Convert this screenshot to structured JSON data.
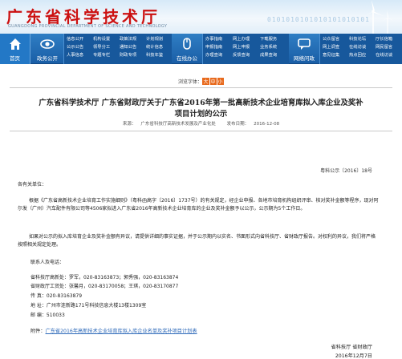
{
  "header": {
    "title": "广东省科学技术厅",
    "subtitle": "GUANGDONG PROVINCIAL DEPARTMENT OF SCIENCE AND TECHNOLOGY",
    "binary_rows": [
      "0101010101010101010101",
      "1010101010101010101010",
      "0101010101010101010101",
      "1010101010101010101010"
    ]
  },
  "nav": {
    "home": "首页",
    "gov_open": {
      "label": "政务公开",
      "links": [
        "信息公开",
        "机构设置",
        "政策法规",
        "计划规划",
        "公示公告",
        "领导分工",
        "通知公告",
        "统计信息",
        "人事信息",
        "专题专栏",
        "财政专项",
        "科技年鉴"
      ]
    },
    "online": {
      "label": "在线办公",
      "links": [
        "办事指南",
        "网上办理",
        "下载服务",
        "申报指南",
        "网上申报",
        "业务系统",
        "办理查询",
        "反馈查询",
        "成果查询"
      ]
    },
    "interact": {
      "label": "网络问政",
      "links": [
        "公众留言",
        "科技论坛",
        "厅长信箱",
        "网上调查",
        "在线访谈",
        "网民留言",
        "意见征集",
        "热点回应",
        "在线访谈"
      ]
    }
  },
  "font_line": {
    "prefix": "浏览字体：",
    "options": [
      "大",
      "中",
      "小"
    ]
  },
  "document": {
    "title_line1": "广东省科学技术厅  广东省财政厅关于广东省2016年第一批高新技术企业培育库拟入库企业及奖补",
    "title_line2": "项目计划的公示",
    "source_label": "来源：",
    "source": "广东省科技厅高新技术发展及产业化处",
    "date_label": "发布日期：",
    "date": "2016-12-08",
    "doc_number": "粤科公示〔2016〕18号",
    "salutation": "各有关单位：",
    "para1": "根据《广东省高新技术企业培育工作实施细则》（粤科函高字〔2016〕1737号）的有关规定，经企业申报、各地市培育机构组织评审、核对奖补金额等程序，现对阿尔发（广州）汽车配件有限公司等4506家拟进入广东省2016年高新技术企业培育库的企业及奖补金额予以公示，公示期为5个工作日。",
    "para2": "如果对公示的拟入库培育企业及奖补金额有异议，请提供详细的事实证据，并于公示期内以实名、书面形式向省科技厅、省财政厅报告。对权利的异议，我们将严格按照相关规定处理。",
    "contacts_title": "联系人及电话：",
    "contacts": [
      "省科技厅高新处：罗军，020-83163873；郭秀强，020-83163874",
      "省财政厅工贸处：张馨月，020-83170058；王琪，020-83170877",
      "传  真：020-83163879",
      "地  址：广州市连新路171号科技信息大楼13楼1309室",
      "邮  编：510033"
    ],
    "attachment_label": "附件：",
    "attachment_link": "广东省2016年高新技术企业培育库拟入库企业名单及奖补项目计划表",
    "sign": "省科技厅  省财政厅",
    "sign_date": "2016年12月7日"
  }
}
